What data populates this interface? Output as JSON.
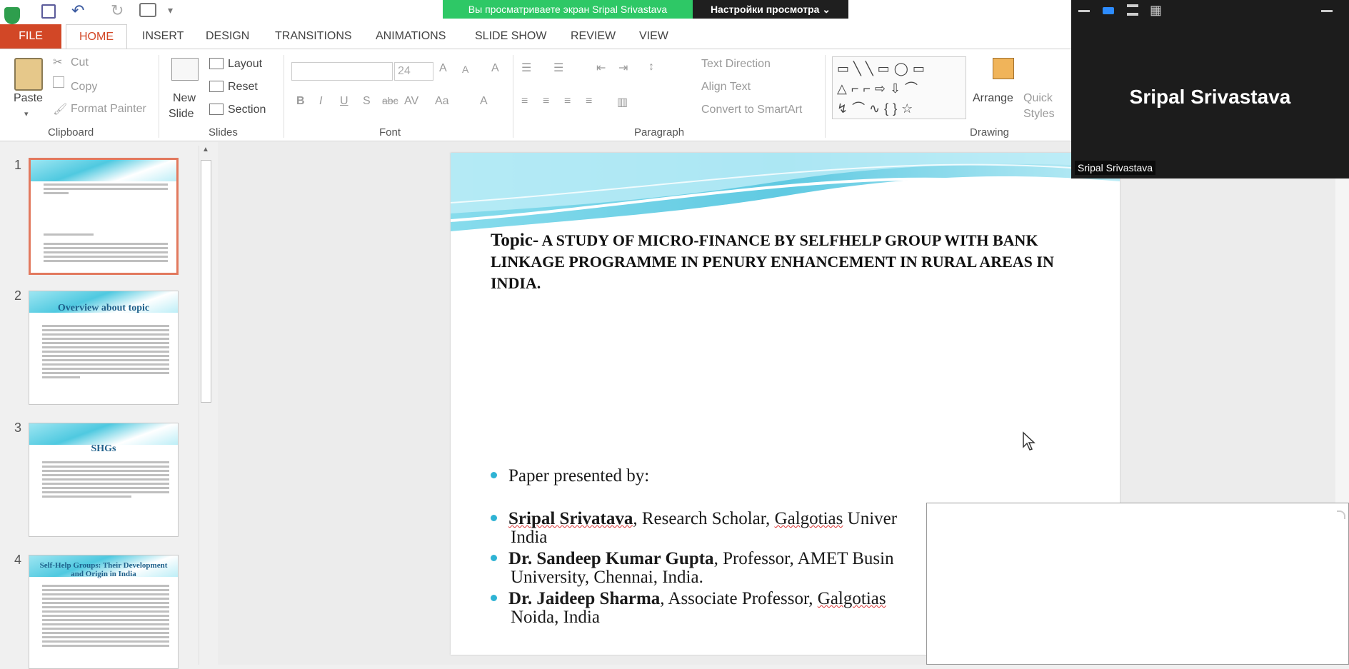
{
  "qat": {
    "title": ""
  },
  "share": {
    "banner": "Вы просматриваете экран Sripal Srivastava",
    "view_options": "Настройки просмотра ⌄"
  },
  "tabs": [
    "FILE",
    "HOME",
    "INSERT",
    "DESIGN",
    "TRANSITIONS",
    "ANIMATIONS",
    "SLIDE SHOW",
    "REVIEW",
    "VIEW"
  ],
  "clipboard": {
    "paste": "Paste",
    "cut": "Cut",
    "copy": "Copy",
    "format_painter": "Format Painter",
    "label": "Clipboard"
  },
  "slides_grp": {
    "new_slide": "New",
    "new_slide2": "Slide",
    "layout": "Layout",
    "reset": "Reset",
    "section": "Section",
    "label": "Slides"
  },
  "font_grp": {
    "size": "24",
    "label": "Font",
    "bold": "B",
    "italic": "I",
    "underline": "U",
    "shadow": "S",
    "strike": "abc",
    "spacing": "AV",
    "case": "Aa",
    "color": "A"
  },
  "para_grp": {
    "text_direction": "Text Direction",
    "align_text": "Align Text",
    "convert_smartart": "Convert to SmartArt",
    "label": "Paragraph"
  },
  "drawing_grp": {
    "arrange": "Arrange",
    "quick": "Quick",
    "styles": "Styles",
    "label": "Drawing"
  },
  "thumbs": [
    {
      "num": "1",
      "title": ""
    },
    {
      "num": "2",
      "title": "Overview about topic"
    },
    {
      "num": "3",
      "title": "SHGs"
    },
    {
      "num": "4",
      "title": "Self-Help Groups: Their Development and Origin in India"
    }
  ],
  "slide": {
    "topic_label": "Topic-",
    "topic_text": " A STUDY OF MICRO-FINANCE BY SELFHELP GROUP WITH BANK LINKAGE PROGRAMME IN PENURY ENHANCEMENT IN RURAL AREAS IN INDIA.",
    "presented_by": "Paper presented by:",
    "a1_name": "Sripal Srivatava",
    "a1_rest": ", Research Scholar, ",
    "a1_org": "Galgotias",
    "a1_tail": " Univer",
    "a1_line2": "India",
    "a2_name": "Dr. Sandeep Kumar Gupta",
    "a2_rest": ", Professor, AMET Busin",
    "a2_line2": "University, Chennai, India.",
    "a3_name": "Dr. Jaideep Sharma",
    "a3_rest": ", Associate Professor, ",
    "a3_org": "Galgotias",
    "a3_line2": "Noida, India"
  },
  "video": {
    "name": "Sripal Srivastava",
    "label": "Sripal Srivastava"
  }
}
